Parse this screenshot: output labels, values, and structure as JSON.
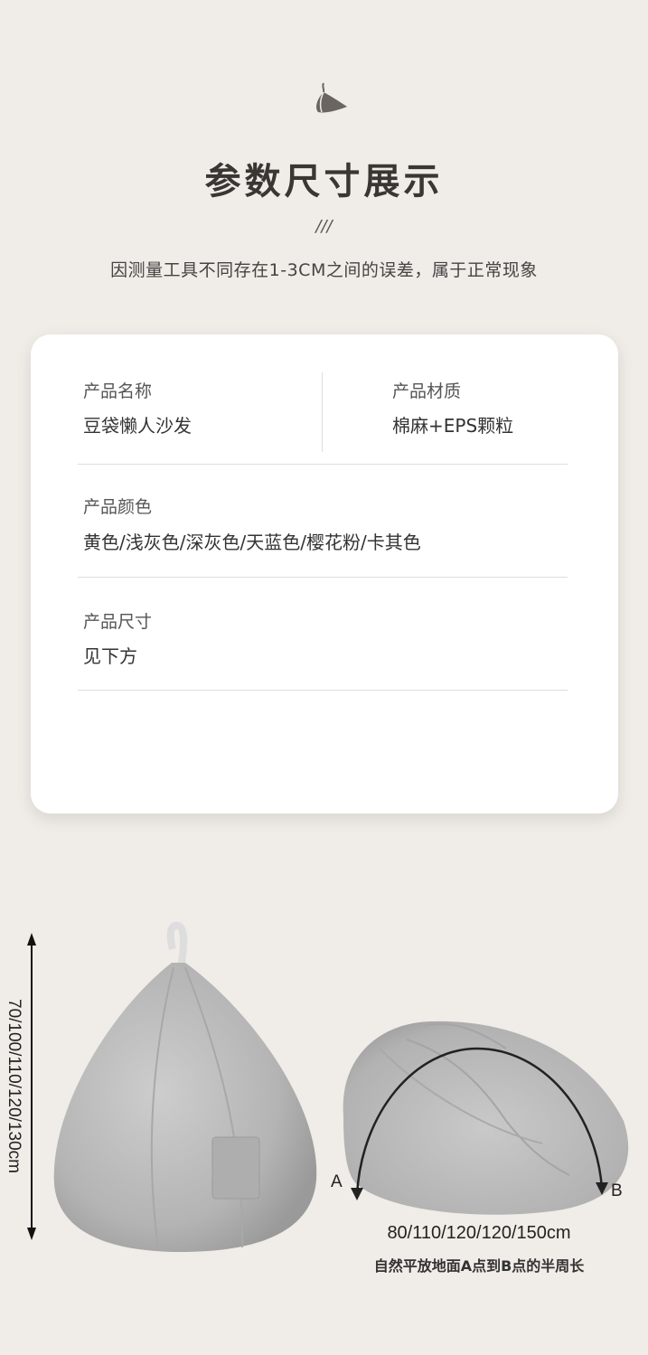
{
  "header": {
    "logo_icon": "teardrop-beanbag-logo-icon",
    "title": "参数尺寸展示",
    "slashes": "///",
    "subtitle": "因测量工具不同存在1-3CM之间的误差，属于正常现象"
  },
  "specs": {
    "name_label": "产品名称",
    "name_value": "豆袋懒人沙发",
    "material_label": "产品材质",
    "material_value": "棉麻+EPS颗粒",
    "color_label": "产品颜色",
    "color_value": "黄色/浅灰色/深灰色/天蓝色/樱花粉/卡其色",
    "size_label": "产品尺寸",
    "size_value": "见下方"
  },
  "dimensions": {
    "height_text": "70/100/110/120/130cm",
    "point_a": "A",
    "point_b": "B",
    "width_text": "80/110/120/120/150cm",
    "width_note": "自然平放地面A点到B点的半周长"
  },
  "colors": {
    "background": "#f0ece7",
    "card": "#ffffff",
    "fabric": "#b9b9b9"
  }
}
